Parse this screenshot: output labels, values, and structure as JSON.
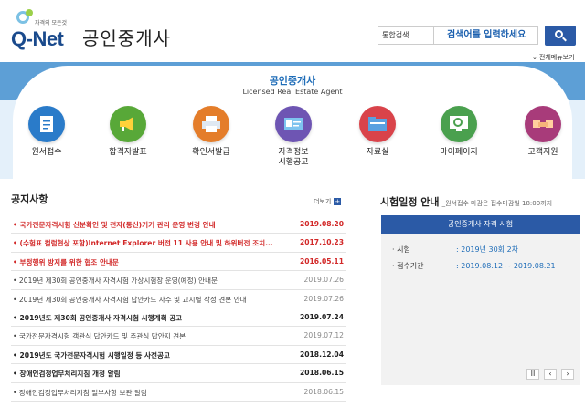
{
  "header": {
    "logo_sub": "자격의 모든것",
    "logo_brand": "Q-Net",
    "site_title": "공인중개사",
    "search_select": "통합검색",
    "search_placeholder": "검색어를 입력하세요",
    "all_menu": "전체메뉴보기"
  },
  "banner": {
    "title": "공인중개사",
    "subtitle": "Licensed Real Estate Agent",
    "menus": [
      {
        "label": "원서접수",
        "icon": "document-icon",
        "color": "#2a7bc9"
      },
      {
        "label": "합격자발표",
        "icon": "megaphone-icon",
        "color": "#58a838"
      },
      {
        "label": "확인서발급",
        "icon": "printer-icon",
        "color": "#e47d2a"
      },
      {
        "label": "자격정보\n시행공고",
        "icon": "id-card-icon",
        "color": "#6e55b3"
      },
      {
        "label": "자료실",
        "icon": "folder-icon",
        "color": "#d9434a"
      },
      {
        "label": "마이페이지",
        "icon": "monitor-search-icon",
        "color": "#4aa04e"
      },
      {
        "label": "고객지원",
        "icon": "handshake-icon",
        "color": "#a83b7a"
      }
    ]
  },
  "notices": {
    "title": "공지사항",
    "more_label": "더보기",
    "items": [
      {
        "text": "국가전문자격시험 신분확인 및 전자(통신)기기 관리 운영 변경 안내",
        "date": "2019.08.20",
        "style": "red",
        "bullet": "•"
      },
      {
        "text": "(수험표 컬럼현상 포함)Internet Explorer 버전 11 사용 안내 및 하위버전 조치...",
        "date": "2017.10.23",
        "style": "red",
        "bullet": "•"
      },
      {
        "text": "부정행위 방지를 위한 협조 안내문",
        "date": "2016.05.11",
        "style": "red",
        "bullet": "•"
      },
      {
        "text": "2019년 제30회 공인중개사 자격시험 가상시험장 운영(예정) 안내문",
        "date": "2019.07.26",
        "style": "gray",
        "bullet": "•"
      },
      {
        "text": "2019년 제30회 공인중개사 자격시험 답안카드 자수 및 교시별 작성 견본 안내",
        "date": "2019.07.26",
        "style": "gray",
        "bullet": "•"
      },
      {
        "text": "2019년도 제30회 공인중개사 자격시험 시행계획 공고",
        "date": "2019.07.24",
        "style": "bold",
        "bullet": "•"
      },
      {
        "text": "국가전문자격시험 객관식 답안카드 및 주관식 답안지 견본",
        "date": "2019.07.12",
        "style": "gray",
        "bullet": "•"
      },
      {
        "text": "2019년도 국가전문자격시험 시행일정 등 사전공고",
        "date": "2018.12.04",
        "style": "bold",
        "bullet": "•"
      },
      {
        "text": "장애인검정업무처리지침 개정 알림",
        "date": "2018.06.15",
        "style": "bold",
        "bullet": "•"
      },
      {
        "text": "장애인검정업무처리지침 일부사항 보완 알림",
        "date": "2018.06.15",
        "style": "gray",
        "bullet": "•"
      }
    ]
  },
  "exam": {
    "title": "시험일정 안내",
    "subtitle": "_원서접수 마감은 접수마감일 18:00까지",
    "box_title": "공인중개사 자격 시험",
    "rows": [
      {
        "key": "· 시험",
        "value": ": 2019년 30회 2차"
      },
      {
        "key": "· 접수기간",
        "value": ": 2019.08.12 ~ 2019.08.21"
      }
    ],
    "controls": {
      "pause": "II",
      "prev": "‹",
      "next": "›"
    }
  }
}
